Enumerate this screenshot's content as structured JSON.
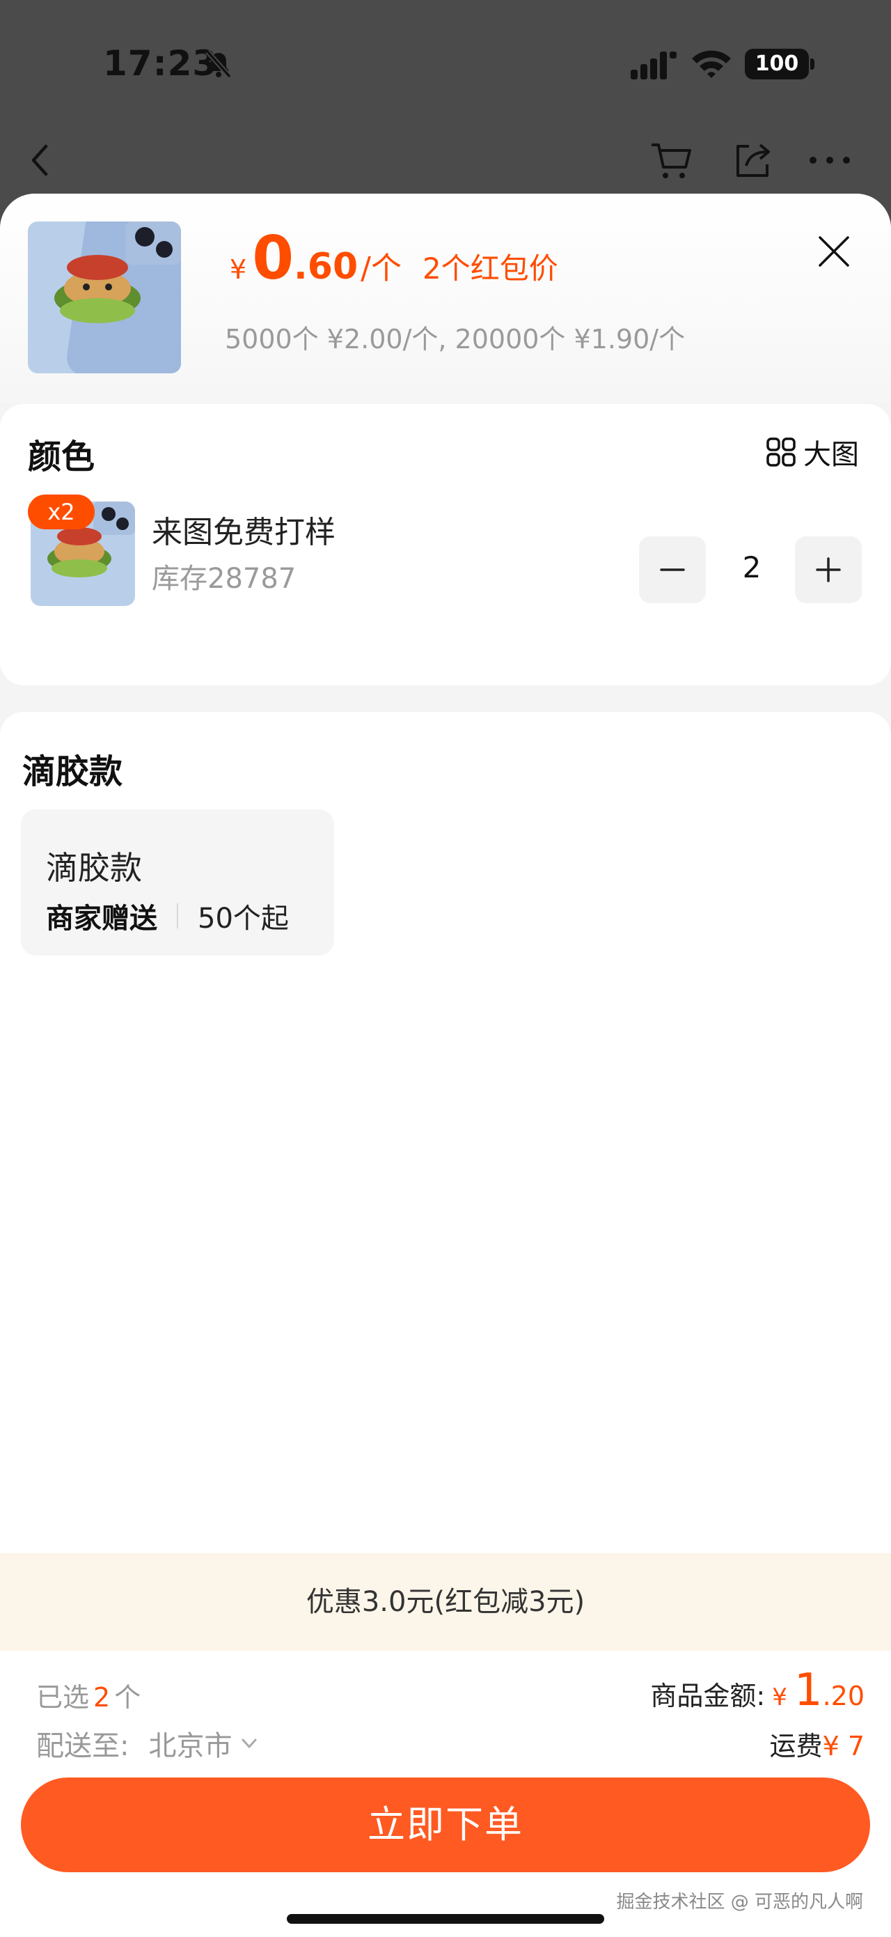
{
  "status_bar": {
    "time": "17:23",
    "battery": "100"
  },
  "product": {
    "price_currency": "¥",
    "price_int": "0",
    "price_dec": ".60",
    "price_unit": "/个",
    "redpack_label": "2个红包价",
    "tier_text": "5000个 ¥2.00/个, 20000个 ¥1.90/个"
  },
  "color_section": {
    "title": "颜色",
    "big_view_label": "大图",
    "sku": {
      "badge": "x2",
      "name": "来图免费打样",
      "stock": "库存28787",
      "quantity": "2"
    }
  },
  "style_section": {
    "title": "滴胶款",
    "option": {
      "name": "滴胶款",
      "gift": "商家赠送",
      "min_order": "50个起"
    }
  },
  "promo_text": "优惠3.0元(红包减3元)",
  "footer": {
    "selected_prefix": "已选",
    "selected_count": "2",
    "selected_suffix": "个",
    "deliver_label": "配送至:",
    "deliver_city": "北京市",
    "total_label": "商品金额:",
    "total_currency": "¥",
    "total_int": "1",
    "total_dec": ".20",
    "shipping_label": "运费",
    "shipping_value": "¥ 7",
    "order_button": "立即下单",
    "watermark": "掘金技术社区 @ 可恶的凡人啊"
  },
  "colors": {
    "accent": "#ff4d00",
    "button": "#ff5a22",
    "promo_bg": "#fcf5e9"
  }
}
